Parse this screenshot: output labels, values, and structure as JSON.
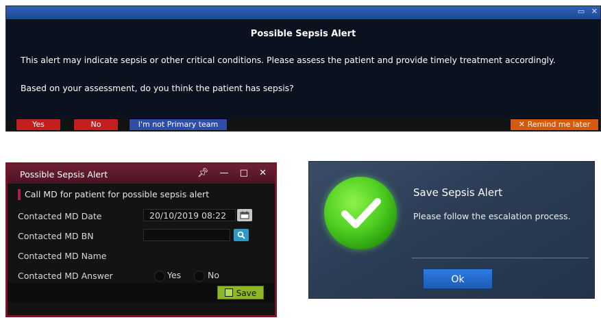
{
  "alert_dialog": {
    "title": "Possible Sepsis Alert",
    "message_line1": "This alert may indicate sepsis or other critical conditions. Please assess the patient and provide timely treatment accordingly.",
    "message_line2": "Based on your assessment, do you think the patient has sepsis?",
    "buttons": {
      "yes": "Yes",
      "no": "No",
      "not_primary": "I'm not Primary team",
      "remind_later": "Remind me later"
    }
  },
  "sepsis_form": {
    "window_title": "Possible Sepsis Alert",
    "section_header": "Call MD for patient for possible sepsis alert",
    "fields": {
      "contacted_md_date_label": "Contacted MD Date",
      "contacted_md_date_value": "20/10/2019 08:22",
      "contacted_md_bn_label": "Contacted MD BN",
      "contacted_md_bn_value": "",
      "contacted_md_name_label": "Contacted MD Name",
      "contacted_md_answer_label": "Contacted MD Answer"
    },
    "answer_options": {
      "yes": "Yes",
      "no": "No"
    },
    "save_label": "Save"
  },
  "save_dialog": {
    "title": "Save Sepsis Alert",
    "message": "Please follow the escalation process.",
    "ok_label": "Ok"
  },
  "colors": {
    "danger_red": "#c41f1f",
    "primary_blue": "#2e4fa8",
    "remind_orange": "#d45a0f",
    "form_border": "#7d1228",
    "save_green": "#8db824",
    "success_green": "#4fcf22",
    "ok_blue": "#1c5bb6"
  }
}
